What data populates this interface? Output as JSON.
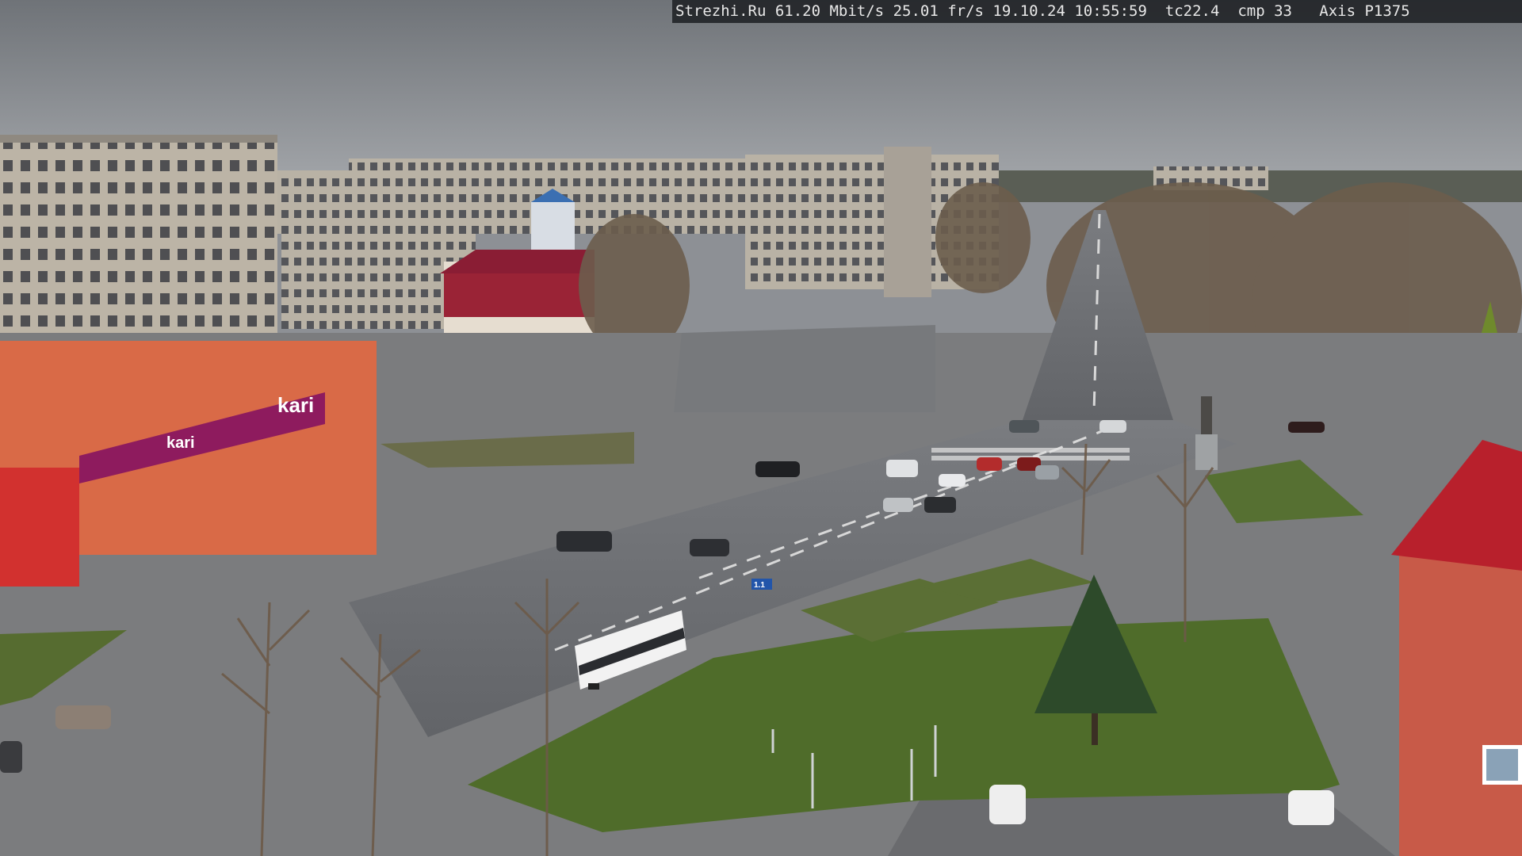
{
  "overlay": {
    "site": "Strezhi.Ru",
    "bitrate": "61.20 Mbit/s",
    "framerate": "25.01 fr/s",
    "datetime": "19.10.24 10:55:59",
    "tc": "tc22.4",
    "cmp": "cmp 33",
    "camera_model": "Axis P1375"
  },
  "signs": {
    "store_brand_main": "kari",
    "store_brand_secondary": "kari",
    "road_sign": "1.1"
  },
  "colors": {
    "sky": "#8c8f94",
    "store_facade": "#8e1b5e",
    "building_orange": "#d96a47",
    "grass": "#4e6b2a",
    "asphalt": "#6f7174"
  }
}
